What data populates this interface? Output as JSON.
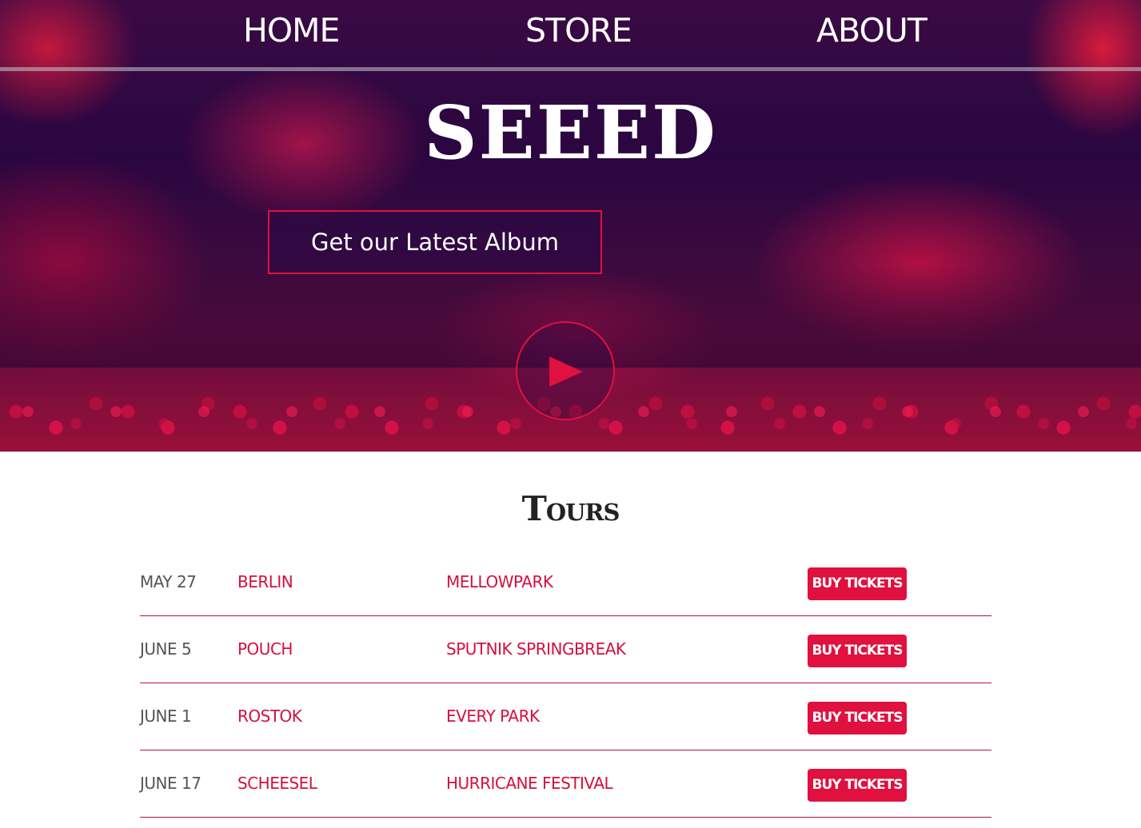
{
  "nav": {
    "home": "HOME",
    "store": "STORE",
    "about": "ABOUT"
  },
  "hero": {
    "band_name": "SEEED",
    "album_button": "Get our Latest Album",
    "play_icon": "play-icon"
  },
  "tours": {
    "title": "Tours",
    "buy_label": "BUY TICKETS",
    "rows": [
      {
        "date": "MAY 27",
        "city": "BERLIN",
        "venue": "MELLOWPARK"
      },
      {
        "date": "JUNE 5",
        "city": "POUCH",
        "venue": "SPUTNIK SPRINGBREAK"
      },
      {
        "date": "JUNE 1",
        "city": "ROSTOK",
        "venue": "EVERY PARK"
      },
      {
        "date": "JUNE 17",
        "city": "SCHEESEL",
        "venue": "HURRICANE FESTIVAL"
      }
    ]
  },
  "colors": {
    "accent": "#e0103f",
    "text_dark": "#222222",
    "date_gray": "#555555"
  }
}
